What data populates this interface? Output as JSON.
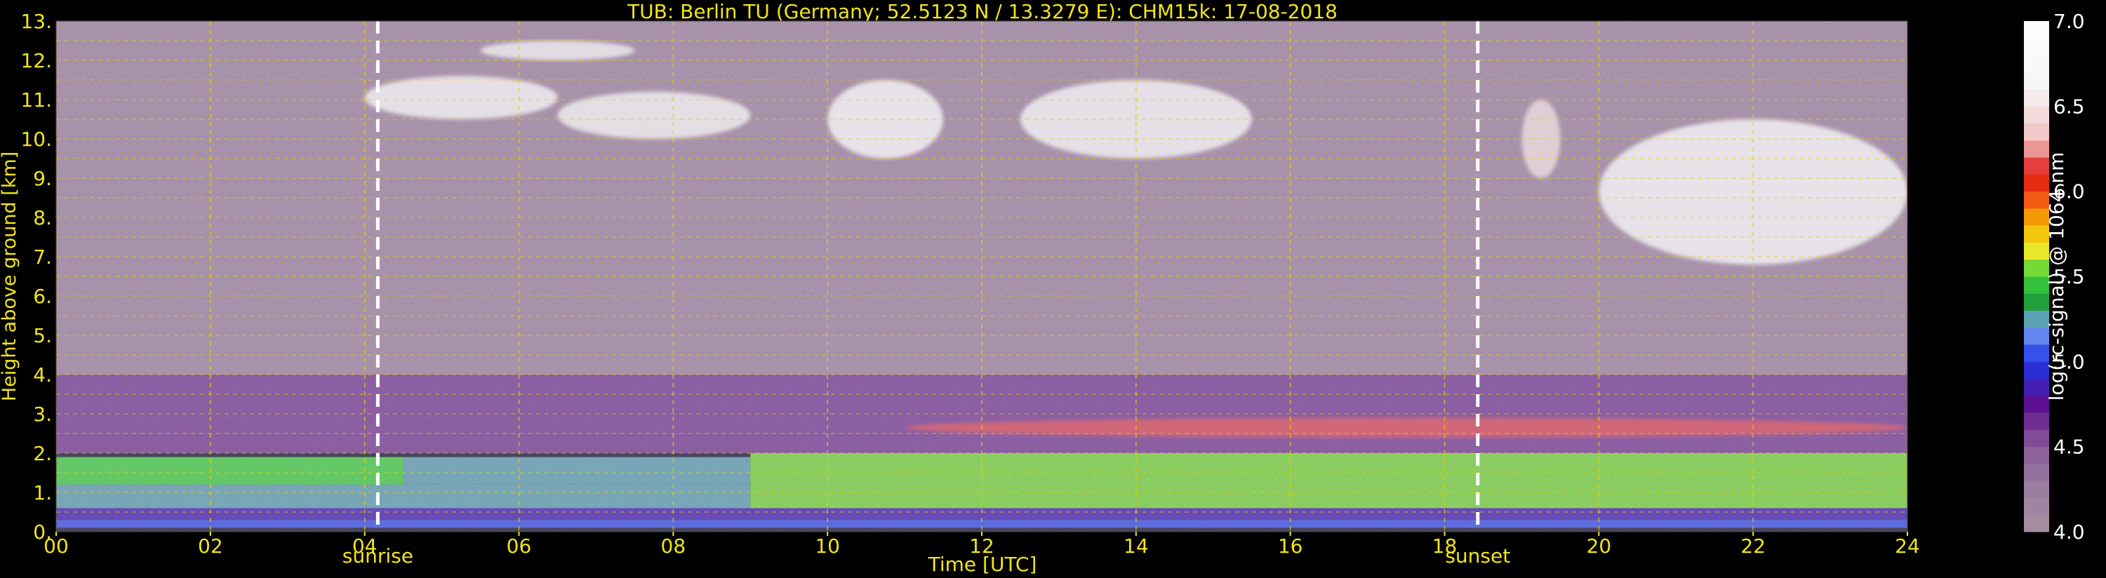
{
  "chart_data": {
    "type": "heatmap",
    "title": "TUB: Berlin TU (Germany; 52.5123 N / 13.3279 E):    CHM15k: 17-08-2018",
    "xlabel": "Time [UTC]",
    "ylabel": "Height above ground [km]",
    "xlim": [
      0,
      24
    ],
    "ylim": [
      0,
      13
    ],
    "x_ticks": [
      "00",
      "02",
      "04",
      "06",
      "08",
      "10",
      "12",
      "14",
      "16",
      "18",
      "20",
      "22",
      "24"
    ],
    "y_ticks": [
      "0.",
      "1.",
      "2.",
      "3.",
      "4.",
      "5.",
      "6.",
      "7.",
      "8.",
      "9.",
      "10.",
      "11.",
      "12.",
      "13."
    ],
    "grid": true,
    "annotations": [
      {
        "x": 4.17,
        "label": "sunrise"
      },
      {
        "x": 18.43,
        "label": "sunset"
      }
    ],
    "colorbar": {
      "label": "log(rc-signal) @ 1064 nm",
      "range": [
        4.0,
        7.0
      ],
      "ticks": [
        "4.0",
        "4.5",
        "5.0",
        "5.5",
        "6.0",
        "6.5",
        "7.0"
      ]
    },
    "layers": [
      {
        "x": [
          0,
          24
        ],
        "y": [
          0.1,
          0.3
        ],
        "value": 5.05
      },
      {
        "x": [
          0,
          24
        ],
        "y": [
          0.3,
          0.6
        ],
        "value": 4.85
      },
      {
        "x": [
          0,
          9
        ],
        "y": [
          0.6,
          1.2
        ],
        "value": 5.25
      },
      {
        "x": [
          0,
          4.5
        ],
        "y": [
          1.2,
          1.9
        ],
        "value": 5.5
      },
      {
        "x": [
          4.5,
          9
        ],
        "y": [
          1.2,
          1.9
        ],
        "value": 5.25
      },
      {
        "x": [
          9,
          24
        ],
        "y": [
          0.6,
          2.0
        ],
        "value": 5.55
      },
      {
        "x": [
          9,
          24
        ],
        "y": [
          2.0,
          3.0
        ],
        "value": 5.3
      },
      {
        "x": [
          0,
          24
        ],
        "y": [
          2.0,
          4.0
        ],
        "value": 4.6
      },
      {
        "x": [
          0,
          24
        ],
        "y": [
          4.0,
          13.0
        ],
        "value": 4.15
      }
    ],
    "clouds": [
      {
        "x": [
          4.0,
          6.5
        ],
        "y": [
          10.5,
          11.6
        ],
        "value": 6.8
      },
      {
        "x": [
          5.5,
          7.5
        ],
        "y": [
          12.0,
          12.5
        ],
        "value": 6.6
      },
      {
        "x": [
          6.5,
          9.0
        ],
        "y": [
          10.0,
          11.2
        ],
        "value": 6.7
      },
      {
        "x": [
          10.0,
          11.5
        ],
        "y": [
          9.5,
          11.5
        ],
        "value": 6.9
      },
      {
        "x": [
          12.5,
          15.5
        ],
        "y": [
          9.5,
          11.5
        ],
        "value": 6.8
      },
      {
        "x": [
          19.0,
          19.5
        ],
        "y": [
          9.0,
          11.0
        ],
        "value": 6.5
      },
      {
        "x": [
          20.0,
          24.0
        ],
        "y": [
          6.8,
          10.5
        ],
        "value": 6.9
      },
      {
        "x": [
          11.0,
          24.0
        ],
        "y": [
          2.4,
          2.9
        ],
        "value": 6.2
      }
    ]
  }
}
